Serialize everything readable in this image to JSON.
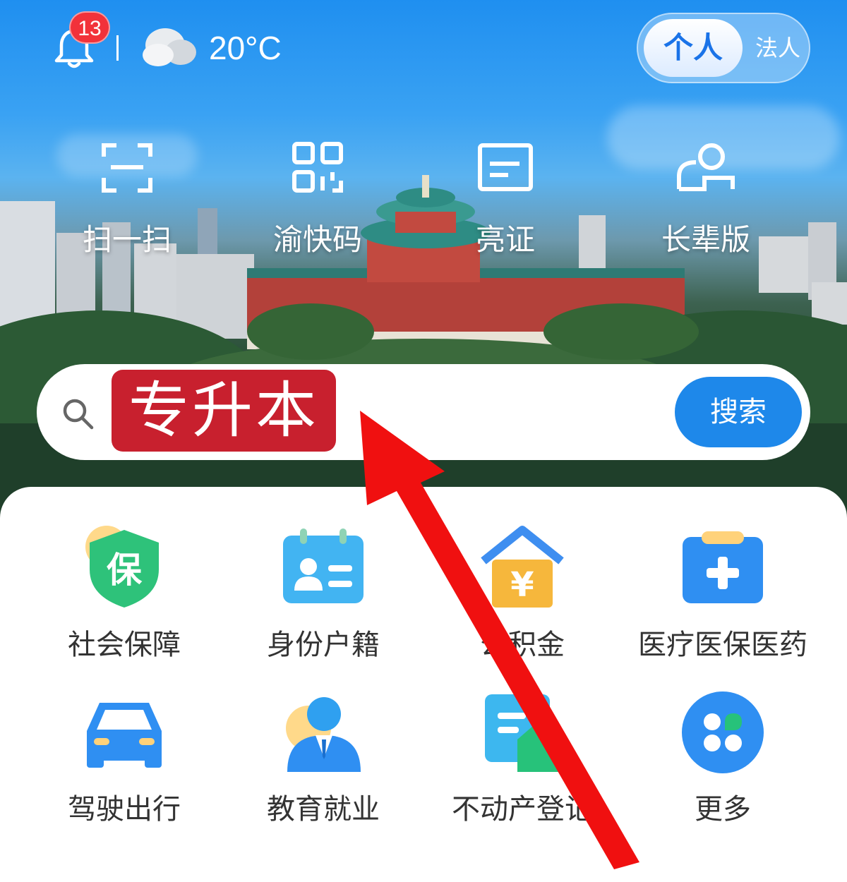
{
  "status": {
    "notification_count": "13",
    "temperature": "20°C",
    "weather_icon": "cloudy-icon"
  },
  "identity_toggle": {
    "active": "个人",
    "other": "法人"
  },
  "quick_actions": [
    {
      "label": "扫一扫",
      "icon": "scan-icon"
    },
    {
      "label": "渝快码",
      "icon": "qr-code-icon"
    },
    {
      "label": "亮证",
      "icon": "id-card-icon"
    },
    {
      "label": "长辈版",
      "icon": "elder-mode-icon"
    }
  ],
  "search": {
    "query": "专升本",
    "button_label": "搜索"
  },
  "services": [
    {
      "label": "社会保障",
      "icon": "social-security-icon"
    },
    {
      "label": "身份户籍",
      "icon": "household-id-icon"
    },
    {
      "label": "公积金",
      "icon": "housing-fund-icon"
    },
    {
      "label": "医疗医保医药",
      "icon": "medical-icon"
    },
    {
      "label": "驾驶出行",
      "icon": "car-icon"
    },
    {
      "label": "教育就业",
      "icon": "education-employment-icon"
    },
    {
      "label": "不动产登记",
      "icon": "real-estate-icon"
    },
    {
      "label": "更多",
      "icon": "more-icon"
    }
  ],
  "colors": {
    "primary": "#1e88ea",
    "badge": "#f2323a",
    "search_tag": "#c8202e",
    "annotation_arrow": "#f01010"
  }
}
